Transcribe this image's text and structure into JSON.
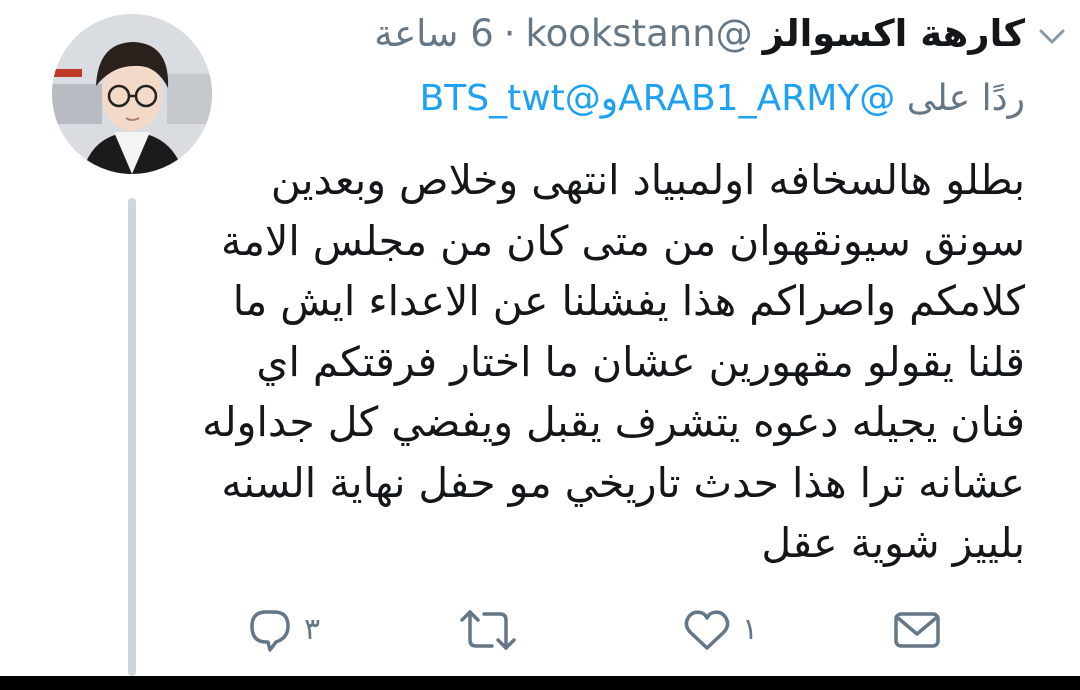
{
  "tweet": {
    "display_name": "كارهة اكسوالز",
    "handle": "@kookstann",
    "separator": "·",
    "time": "6 ساعة",
    "reply_prefix": "ردًا على",
    "reply_mention_1": "@ARAB1_ARMY",
    "reply_connector": "و",
    "reply_mention_2": "@BTS_twt",
    "text_lines": [
      "بطلو هالسخافه اولمبياد انتهى وخلاص وبعدين",
      "سونق سيونقهوان من متى كان من مجلس الامة",
      "كلامكم واصراكم هذا يفشلنا عن الاعداء ايش ما",
      "قلنا يقولو مقهورين عشان ما اختار فرقتكم اي",
      "فنان يجيله دعوه يتشرف يقبل ويفضي كل جداوله",
      "عشانه ترا هذا حدث تاريخي مو حفل نهاية السنه",
      "بلييز شوية عقل"
    ]
  },
  "actions": {
    "reply_count": "٣",
    "retweet_count": "",
    "like_count": "١"
  },
  "icons": {
    "avatar": "profile-photo",
    "chevron": "chevron-down-icon",
    "reply": "reply-icon",
    "retweet": "retweet-icon",
    "like": "heart-icon",
    "dm": "envelope-icon"
  },
  "colors": {
    "link": "#1da1f2",
    "secondary": "#657786",
    "text": "#14171a",
    "thread_line": "#ccd6dd"
  }
}
